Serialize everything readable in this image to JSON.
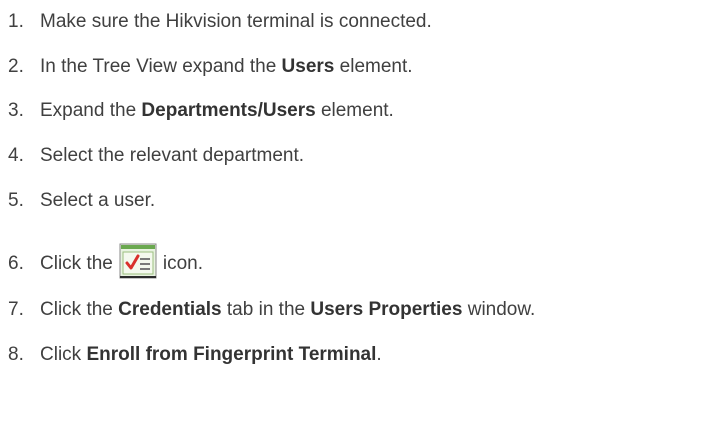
{
  "steps": [
    {
      "number": "1.",
      "parts": [
        {
          "text": "Make sure the Hikvision terminal is connected.",
          "bold": false
        }
      ]
    },
    {
      "number": "2.",
      "parts": [
        {
          "text": "In the Tree View expand the ",
          "bold": false
        },
        {
          "text": "Users",
          "bold": true
        },
        {
          "text": " element.",
          "bold": false
        }
      ]
    },
    {
      "number": "3.",
      "parts": [
        {
          "text": "Expand the ",
          "bold": false
        },
        {
          "text": "Departments/Users",
          "bold": true
        },
        {
          "text": " element.",
          "bold": false
        }
      ]
    },
    {
      "number": "4.",
      "parts": [
        {
          "text": "Select the relevant department.",
          "bold": false
        }
      ]
    },
    {
      "number": "5.",
      "parts": [
        {
          "text": "Select a user.",
          "bold": false
        }
      ]
    },
    {
      "number": "6.",
      "parts": [
        {
          "text": "Click the",
          "bold": false
        },
        {
          "icon": "user-properties-icon"
        },
        {
          "text": "icon.",
          "bold": false
        }
      ]
    },
    {
      "number": "7.",
      "parts": [
        {
          "text": "Click the ",
          "bold": false
        },
        {
          "text": "Credentials",
          "bold": true
        },
        {
          "text": " tab in the ",
          "bold": false
        },
        {
          "text": "Users Properties",
          "bold": true
        },
        {
          "text": " window.",
          "bold": false
        }
      ]
    },
    {
      "number": "8.",
      "parts": [
        {
          "text": "Click ",
          "bold": false
        },
        {
          "text": "Enroll from Fingerprint Terminal",
          "bold": true
        },
        {
          "text": ".",
          "bold": false
        }
      ]
    }
  ],
  "colors": {
    "text": "#404040",
    "icon_frame": "#8a8a8a",
    "icon_bg": "#e8f3e0",
    "icon_header": "#6aa84f",
    "icon_check": "#d9302c"
  }
}
